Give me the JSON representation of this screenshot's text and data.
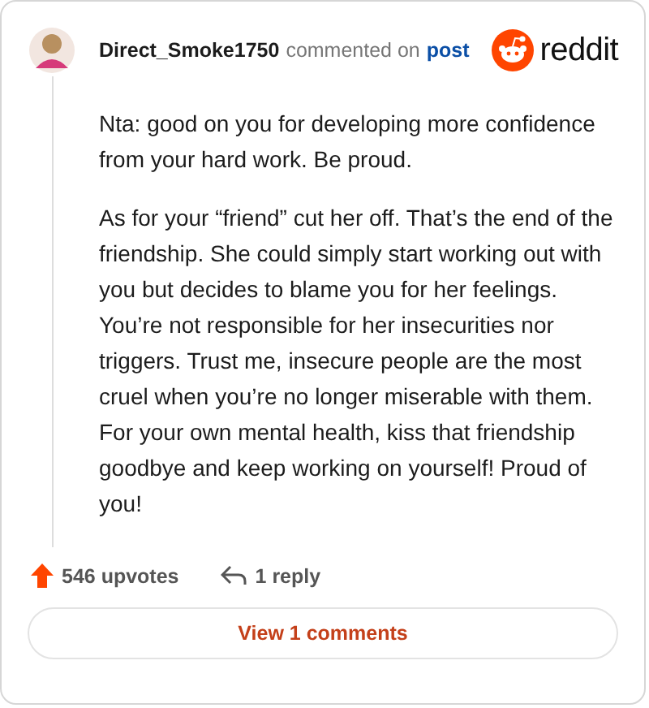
{
  "comment": {
    "author": "Direct_Smoke1750",
    "action": "commented on",
    "target": "post",
    "brand": "reddit",
    "paragraphs": [
      "Nta: good on you for developing more confidence from your hard work. Be proud.",
      "As for your “friend” cut her off. That’s the end of the friendship. She could simply start working out with you but decides to blame you for her feelings. You’re not responsible for her insecurities nor triggers. Trust me, insecure people are the most cruel when you’re no longer miserable with them. For your own mental health, kiss that friendship goodbye and keep working on yourself! Proud of you!"
    ],
    "upvotes": "546 upvotes",
    "replies": "1 reply"
  },
  "view_button": "View 1 comments"
}
